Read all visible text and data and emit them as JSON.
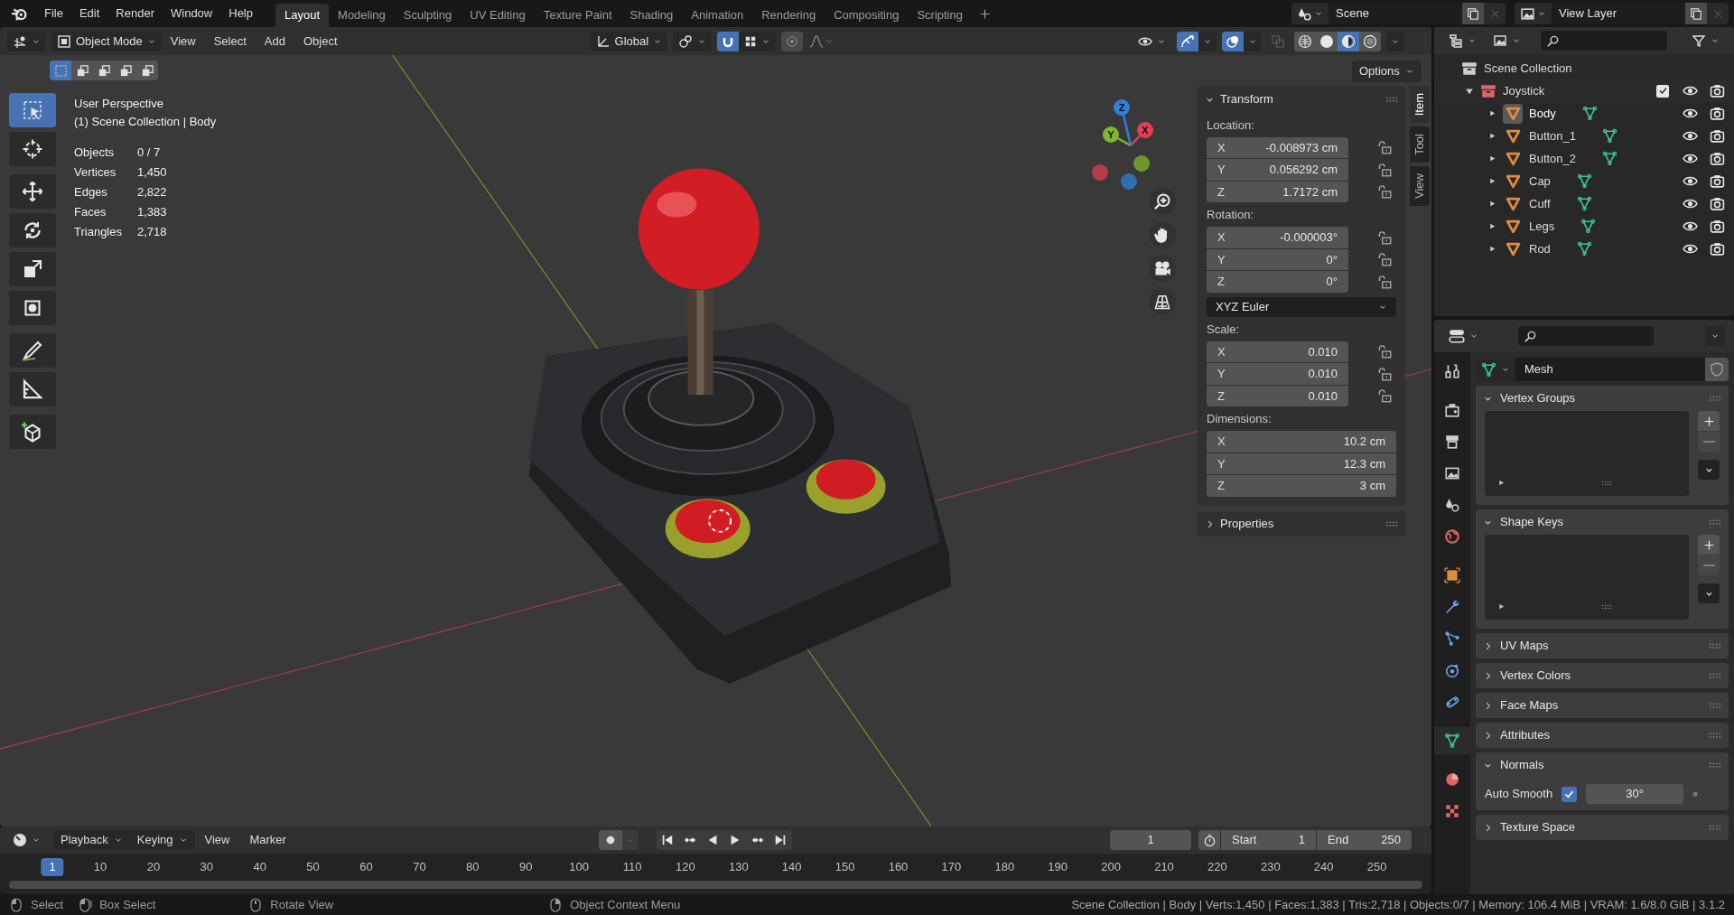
{
  "menu_bar": {
    "menus": [
      "File",
      "Edit",
      "Render",
      "Window",
      "Help"
    ]
  },
  "workspaces": [
    {
      "label": "Layout",
      "selected": true
    },
    {
      "label": "Modeling",
      "selected": false
    },
    {
      "label": "Sculpting",
      "selected": false
    },
    {
      "label": "UV Editing",
      "selected": false
    },
    {
      "label": "Texture Paint",
      "selected": false
    },
    {
      "label": "Shading",
      "selected": false
    },
    {
      "label": "Animation",
      "selected": false
    },
    {
      "label": "Rendering",
      "selected": false
    },
    {
      "label": "Compositing",
      "selected": false
    },
    {
      "label": "Scripting",
      "selected": false
    }
  ],
  "scene": "Scene",
  "view_layer": "View Layer",
  "viewport_header": {
    "mode": "Object Mode",
    "menus": [
      "View",
      "Select",
      "Add",
      "Object"
    ],
    "orientation": "Global",
    "snap": true,
    "proportional": false,
    "gizmos": true,
    "overlays": true,
    "xray": false,
    "options": "Options"
  },
  "shading_modes": [
    {
      "kind": "wireframe",
      "selected": false
    },
    {
      "kind": "solid",
      "selected": false
    },
    {
      "kind": "material",
      "selected": true
    },
    {
      "kind": "rendered",
      "selected": false
    }
  ],
  "select_modes": [
    {
      "selected": true
    },
    {
      "selected": false
    },
    {
      "selected": false
    },
    {
      "selected": false
    },
    {
      "selected": false
    }
  ],
  "tools": [
    {
      "kind": "select",
      "selected": true
    },
    {
      "kind": "cursor",
      "selected": false
    },
    {
      "kind": "move",
      "selected": false
    },
    {
      "kind": "rotate",
      "selected": false
    },
    {
      "kind": "scale",
      "selected": false
    },
    {
      "kind": "transform",
      "selected": false
    },
    {
      "kind": "annotate",
      "selected": false
    },
    {
      "kind": "measure",
      "selected": false
    },
    {
      "kind": "add_cube",
      "selected": false
    }
  ],
  "overlay_info": {
    "title": "User Perspective",
    "subtitle": "(1) Scene Collection | Body",
    "stats": [
      {
        "label": "Objects",
        "value": "0 / 7"
      },
      {
        "label": "Vertices",
        "value": "1,450"
      },
      {
        "label": "Edges",
        "value": "2,822"
      },
      {
        "label": "Faces",
        "value": "1,383"
      },
      {
        "label": "Triangles",
        "value": "2,718"
      }
    ]
  },
  "gizmo_axes": [
    {
      "label": "X",
      "color": "#e2404f"
    },
    {
      "label": "Y",
      "color": "#7fb62c"
    },
    {
      "label": "Z",
      "color": "#2f80d8"
    }
  ],
  "n_panel": {
    "tabs": [
      {
        "label": "Item",
        "selected": true
      },
      {
        "label": "Tool",
        "selected": false
      },
      {
        "label": "View",
        "selected": false
      }
    ],
    "transform": {
      "title": "Transform",
      "expanded": true,
      "groups": [
        {
          "label": "Location:",
          "lockable": true,
          "fields": [
            {
              "axis": "X",
              "value": "-0.008973 cm"
            },
            {
              "axis": "Y",
              "value": "0.056292 cm"
            },
            {
              "axis": "Z",
              "value": "1.7172 cm"
            }
          ]
        },
        {
          "label": "Rotation:",
          "lockable": true,
          "fields": [
            {
              "axis": "X",
              "value": "-0.000003°"
            },
            {
              "axis": "Y",
              "value": "0°"
            },
            {
              "axis": "Z",
              "value": "0°"
            }
          ],
          "mode": "XYZ Euler"
        },
        {
          "label": "Scale:",
          "lockable": true,
          "fields": [
            {
              "axis": "X",
              "value": "0.010"
            },
            {
              "axis": "Y",
              "value": "0.010"
            },
            {
              "axis": "Z",
              "value": "0.010"
            }
          ]
        },
        {
          "label": "Dimensions:",
          "lockable": false,
          "fields": [
            {
              "axis": "X",
              "value": "10.2 cm"
            },
            {
              "axis": "Y",
              "value": "12.3 cm"
            },
            {
              "axis": "Z",
              "value": "3 cm"
            }
          ]
        }
      ]
    },
    "properties": {
      "title": "Properties",
      "expanded": false
    }
  },
  "outliner": {
    "root": "Scene Collection",
    "collection": {
      "name": "Joystick",
      "expanded": true,
      "checked": true,
      "children": [
        {
          "name": "Body",
          "selected": true,
          "expanded": false
        },
        {
          "name": "Button_1",
          "selected": false,
          "expanded": false
        },
        {
          "name": "Button_2",
          "selected": false,
          "expanded": false
        },
        {
          "name": "Cap",
          "selected": false,
          "expanded": false
        },
        {
          "name": "Cuff",
          "selected": false,
          "expanded": false
        },
        {
          "name": "Legs",
          "selected": false,
          "expanded": false
        },
        {
          "name": "Rod",
          "selected": false,
          "expanded": false
        }
      ]
    }
  },
  "properties_editor": {
    "tabs": [
      {
        "kind": "tool",
        "selected": false
      },
      {
        "kind": "render",
        "selected": false
      },
      {
        "kind": "output",
        "selected": false
      },
      {
        "kind": "view_layer",
        "selected": false
      },
      {
        "kind": "scene",
        "selected": false
      },
      {
        "kind": "world",
        "selected": false
      },
      {
        "kind": "object",
        "selected": false
      },
      {
        "kind": "modifiers",
        "selected": false
      },
      {
        "kind": "particles",
        "selected": false
      },
      {
        "kind": "physics",
        "selected": false
      },
      {
        "kind": "constraints",
        "selected": false
      },
      {
        "kind": "data",
        "selected": true
      },
      {
        "kind": "material",
        "selected": false
      },
      {
        "kind": "texture",
        "selected": false
      }
    ],
    "data_block": "Mesh",
    "panels": [
      {
        "title": "Vertex Groups",
        "kind": "list",
        "expanded": true
      },
      {
        "title": "Shape Keys",
        "kind": "list",
        "expanded": true
      },
      {
        "title": "UV Maps",
        "expanded": false
      },
      {
        "title": "Vertex Colors",
        "expanded": false
      },
      {
        "title": "Face Maps",
        "expanded": false
      },
      {
        "title": "Attributes",
        "expanded": false
      },
      {
        "title": "Normals",
        "kind": "normals",
        "expanded": true,
        "option": {
          "label": "Auto Smooth",
          "checked": true,
          "angle": "30°"
        }
      },
      {
        "title": "Texture Space",
        "expanded": false
      }
    ]
  },
  "timeline": {
    "menus": [
      "Playback",
      "Keying",
      "View",
      "Marker"
    ],
    "auto_keying": false,
    "current_frame": "1",
    "start_label": "Start",
    "start": "1",
    "end_label": "End",
    "end": "250",
    "ruler": [
      {
        "label": "1",
        "selected": true
      },
      {
        "label": "10",
        "selected": false
      },
      {
        "label": "20",
        "selected": false
      },
      {
        "label": "30",
        "selected": false
      },
      {
        "label": "40",
        "selected": false
      },
      {
        "label": "50",
        "selected": false
      },
      {
        "label": "60",
        "selected": false
      },
      {
        "label": "70",
        "selected": false
      },
      {
        "label": "80",
        "selected": false
      },
      {
        "label": "90",
        "selected": false
      },
      {
        "label": "100",
        "selected": false
      },
      {
        "label": "110",
        "selected": false
      },
      {
        "label": "120",
        "selected": false
      },
      {
        "label": "130",
        "selected": false
      },
      {
        "label": "140",
        "selected": false
      },
      {
        "label": "150",
        "selected": false
      },
      {
        "label": "160",
        "selected": false
      },
      {
        "label": "170",
        "selected": false
      },
      {
        "label": "180",
        "selected": false
      },
      {
        "label": "190",
        "selected": false
      },
      {
        "label": "200",
        "selected": false
      },
      {
        "label": "210",
        "selected": false
      },
      {
        "label": "220",
        "selected": false
      },
      {
        "label": "230",
        "selected": false
      },
      {
        "label": "240",
        "selected": false
      },
      {
        "label": "250",
        "selected": false
      }
    ]
  },
  "status_bar": {
    "hints": [
      {
        "kind": "left",
        "label": "Select"
      },
      {
        "kind": "drag",
        "label": "Box Select"
      },
      {
        "kind": "middle",
        "label": "Rotate View"
      },
      {
        "kind": "right",
        "label": "Object Context Menu"
      }
    ],
    "stats": "Scene Collection | Body | Verts:1,450 | Faces:1,383 | Tris:2,718 | Objects:0/7 | Memory: 106.4 MiB | VRAM: 1.6/8.0 GiB | 3.1.2"
  }
}
